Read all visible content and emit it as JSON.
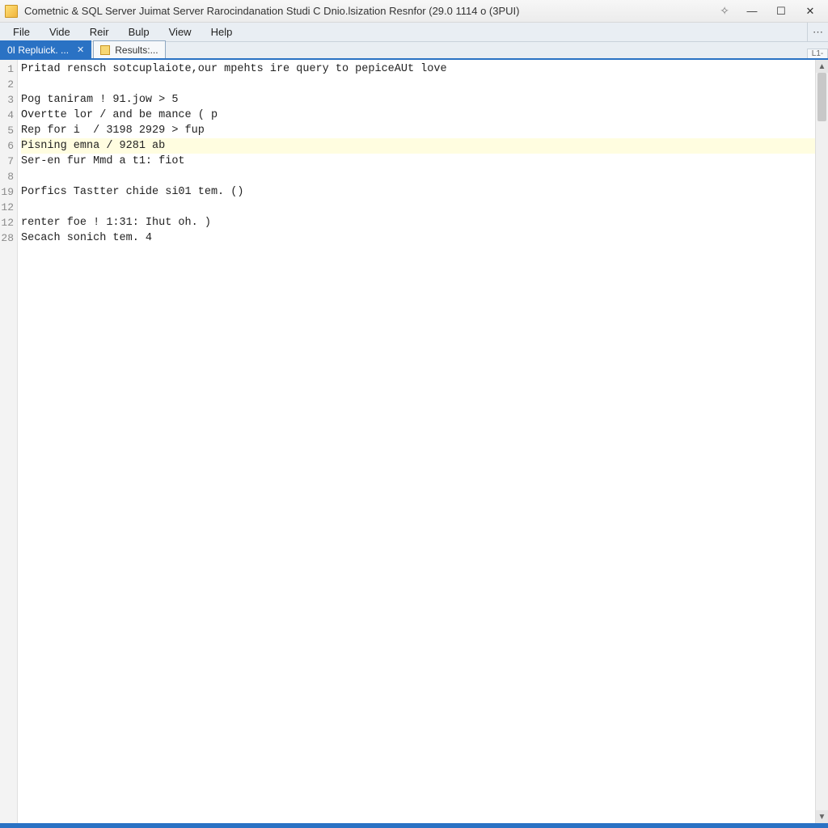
{
  "window": {
    "title": "Cometnic & SQL Server Juimat Server Rarocindanation Studi C Dnio.lsization Resnfor (29.0 1114 o (3PUI)"
  },
  "menu": {
    "items": [
      "File",
      "Vide",
      "Reir",
      "Bulp",
      "View",
      "Help"
    ]
  },
  "tabs": {
    "active_label": "0I Repluick. ...",
    "inactive_label": "Results:..."
  },
  "editor": {
    "highlight_index": 5,
    "lines": [
      {
        "num": "1",
        "text": "Pritad rensch sotcuplaiote,our mpehts ire query to pepiceAUt love"
      },
      {
        "num": "2",
        "text": ""
      },
      {
        "num": "3",
        "text": "Pog taniram ! 91.jow > 5"
      },
      {
        "num": "4",
        "text": "Overtte lor / and be mance ( p"
      },
      {
        "num": "5",
        "text": "Rep for i  / 3198 2929 > fup"
      },
      {
        "num": "6",
        "text": "Pisning emna / 9281 ab"
      },
      {
        "num": "7",
        "text": "Ser-en fur Mmd a t1: fiot"
      },
      {
        "num": "8",
        "text": ""
      },
      {
        "num": "19",
        "text": "Porfics Tastter chide si01 tem. ()"
      },
      {
        "num": "12",
        "text": ""
      },
      {
        "num": "12",
        "text": "renter foe ! 1:31: Ihut oh. )"
      },
      {
        "num": "28",
        "text": "Secach sonich tem. 4"
      }
    ]
  },
  "glyphs": {
    "minimize": "—",
    "maximize": "☐",
    "close": "✕",
    "star": "✧",
    "overflow": "⋯",
    "up": "▲",
    "down": "▼",
    "corner": "L1-"
  }
}
